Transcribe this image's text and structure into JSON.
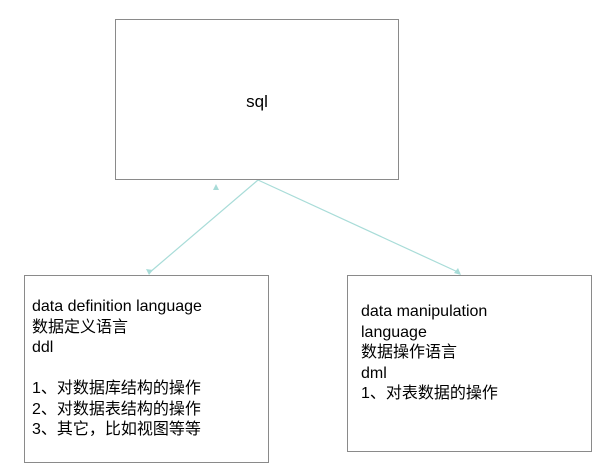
{
  "diagram": {
    "root": {
      "label": "sql"
    },
    "ddl_box": {
      "lines": [
        "data definition language",
        "数据定义语言",
        "ddl"
      ],
      "items": [
        "1、对数据库结构的操作",
        "2、对数据表结构的操作",
        "3、其它，比如视图等等"
      ]
    },
    "dml_box": {
      "lines": [
        "data manipulation",
        "language",
        "数据操作语言",
        "dml"
      ],
      "items": [
        "1、对表数据的操作"
      ]
    },
    "colors": {
      "connector": "#a8dcd8",
      "box_border": "#8a8a8a"
    }
  }
}
